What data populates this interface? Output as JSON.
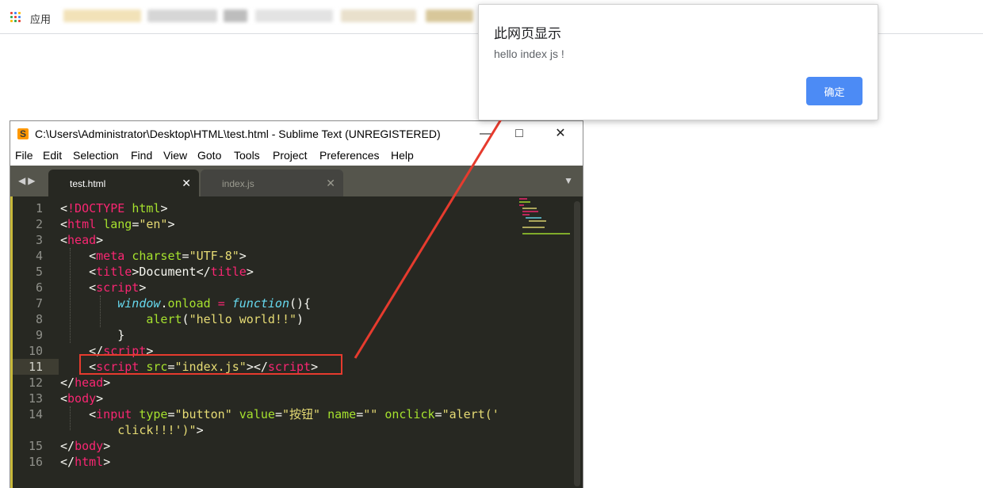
{
  "browser": {
    "apps_label": "应用"
  },
  "editor_window": {
    "title": "C:\\Users\\Administrator\\Desktop\\HTML\\test.html - Sublime Text (UNREGISTERED)",
    "menu": [
      "File",
      "Edit",
      "Selection",
      "Find",
      "View",
      "Goto",
      "Tools",
      "Project",
      "Preferences",
      "Help"
    ],
    "tabs": [
      {
        "label": "test.html",
        "active": true
      },
      {
        "label": "index.js",
        "active": false
      }
    ],
    "line_numbers": [
      "1",
      "2",
      "3",
      "4",
      "5",
      "6",
      "7",
      "8",
      "9",
      "10",
      "11",
      "12",
      "13",
      "14",
      "",
      "15",
      "16"
    ],
    "highlighted_line": 11
  },
  "alert": {
    "title": "此网页显示",
    "message": "hello index js !",
    "ok_label": "确定"
  },
  "colors": {
    "accent_button": "#4c8bf5",
    "annotation": "#e63b2e",
    "editor_bg": "#272822"
  }
}
